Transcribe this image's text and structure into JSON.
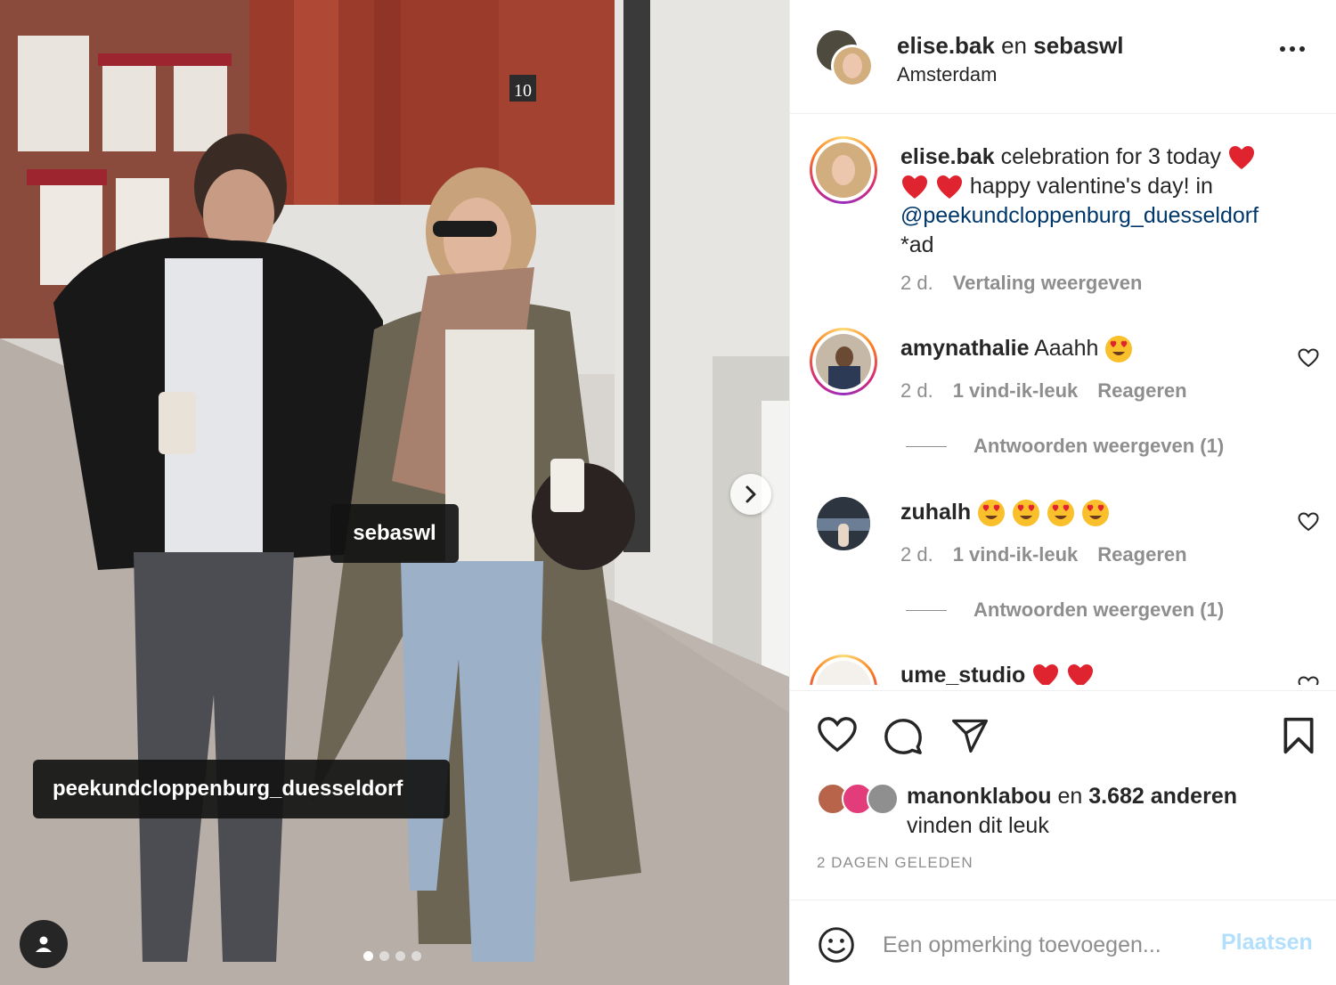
{
  "photo": {
    "tags": [
      "sebaswl",
      "peekundcloppenburg_duesseldorf"
    ],
    "house_number": "10",
    "carousel_count": 4,
    "carousel_active": 0
  },
  "header": {
    "user1": "elise.bak",
    "joiner": "en",
    "user2": "sebaswl",
    "location": "Amsterdam"
  },
  "caption": {
    "username": "elise.bak",
    "text1": "celebration for 3 today",
    "text2": "happy valentine's day! in",
    "mention": "@peekundcloppenburg_duesseldorf",
    "text3": "*ad",
    "time": "2 d.",
    "translate": "Vertaling weergeven"
  },
  "comments": [
    {
      "username": "amynathalie",
      "text": "Aaahh",
      "time": "2 d.",
      "likes": "1 vind-ik-leuk",
      "reply": "Reageren",
      "view_replies": "Antwoorden weergeven (1)"
    },
    {
      "username": "zuhalh",
      "text": "",
      "time": "2 d.",
      "likes": "1 vind-ik-leuk",
      "reply": "Reageren",
      "view_replies": "Antwoorden weergeven (1)"
    },
    {
      "username": "ume_studio",
      "text": ""
    }
  ],
  "likes": {
    "user": "manonklabou",
    "joiner": "en",
    "others": "3.682 anderen",
    "suffix": "vinden dit leuk"
  },
  "time_ago": "2 DAGEN GELEDEN",
  "comment_box": {
    "placeholder": "Een opmerking toevoegen...",
    "post_label": "Plaatsen"
  },
  "icons": [
    "heart-icon",
    "comment-icon",
    "share-icon",
    "bookmark-icon",
    "smiley-icon",
    "more-icon",
    "chevron-right-icon",
    "user-tag-icon"
  ],
  "colors": {
    "link": "#00376b",
    "muted": "#8e8e8e",
    "post_disabled": "#b2dffc"
  }
}
